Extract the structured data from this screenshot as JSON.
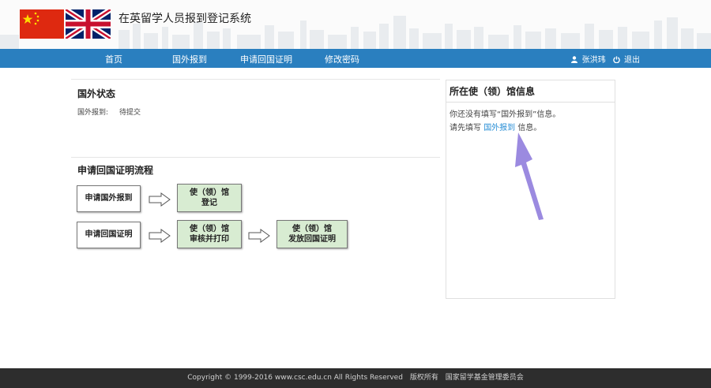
{
  "header": {
    "title": "在英留学人员报到登记系统"
  },
  "nav": {
    "items": [
      "首页",
      "国外报到",
      "申请回国证明",
      "修改密码"
    ],
    "user_name": "张洪玮",
    "logout_label": "退出"
  },
  "status": {
    "title": "国外状态",
    "report_label": "国外报到:",
    "report_value": "待提交"
  },
  "flow": {
    "title": "申请回国证明流程",
    "row1": {
      "start": "申请国外报到",
      "step1": "使（领）馆\n登记"
    },
    "row2": {
      "start": "申请回国证明",
      "step1": "使（领）馆\n审核并打印",
      "step2": "使（领）馆\n发放回国证明"
    }
  },
  "embassy": {
    "title": "所在使（领）馆信息",
    "line1": "你还没有填写“国外报到”信息。",
    "line2_prefix": "请先填写",
    "line2_link": "国外报到",
    "line2_suffix": "信息。"
  },
  "footer": {
    "copyright": "Copyright © 1999-2016 www.csc.edu.cn All Rights Reserved",
    "rights": "版权所有",
    "org": "国家留学基金管理委员会"
  },
  "colors": {
    "nav_bg": "#2a7fbf",
    "link": "#2a8fd6",
    "step_green": "#d8ecd2",
    "pointer": "#9b8ae0",
    "footer_bg": "#2d2d2d"
  }
}
